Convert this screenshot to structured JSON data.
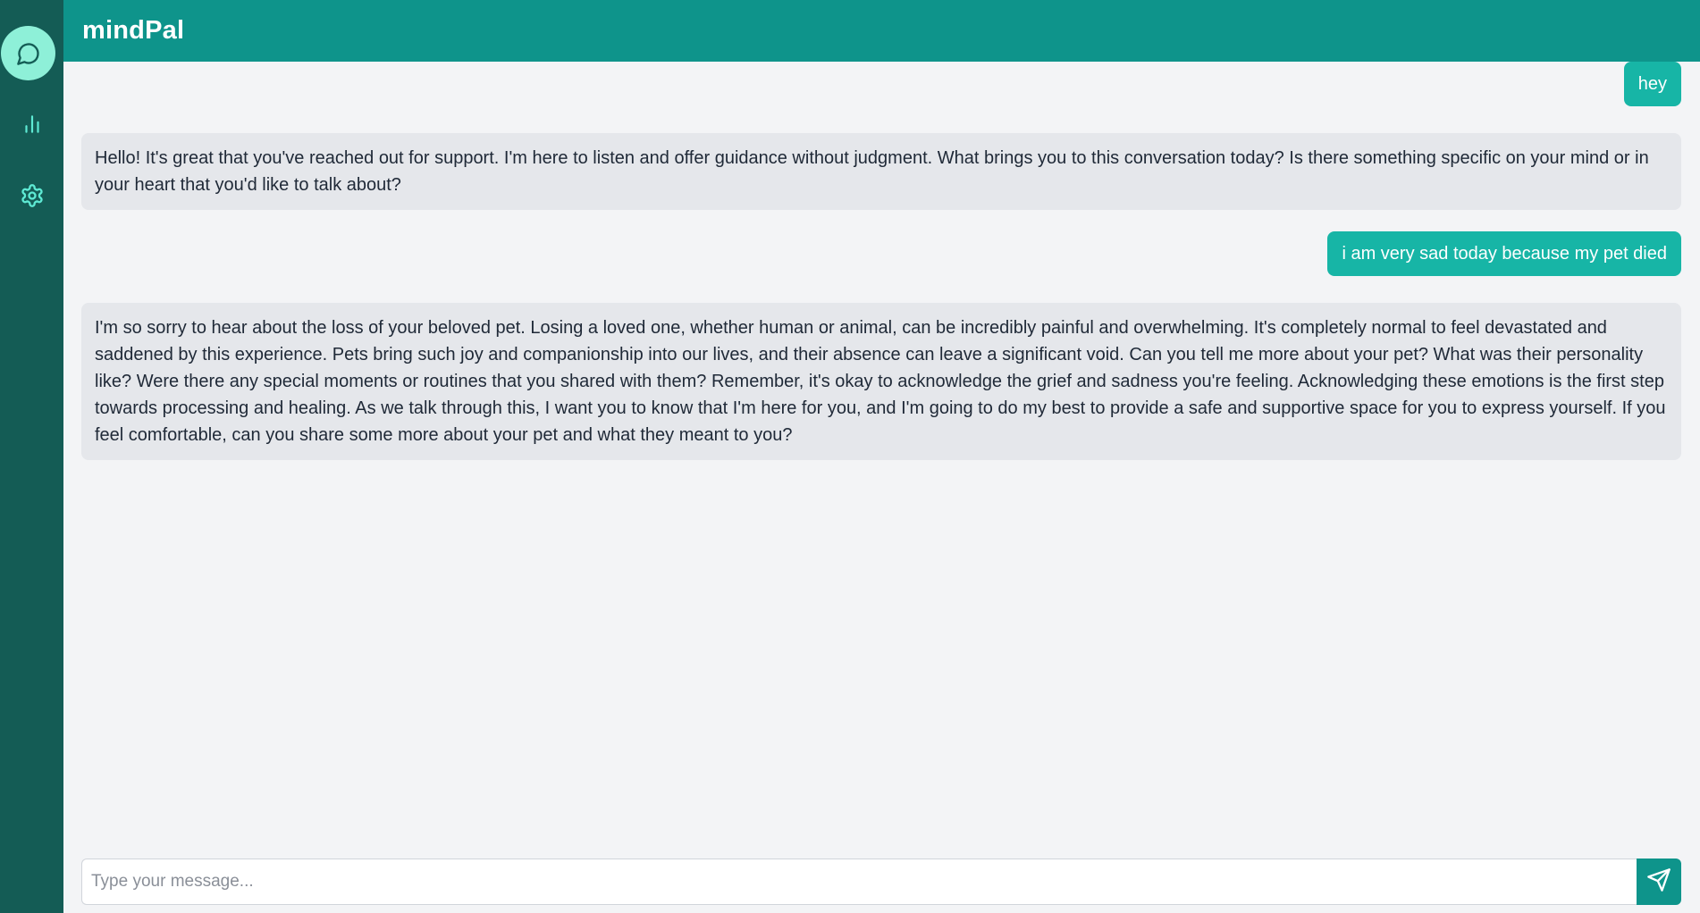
{
  "app": {
    "title": "mindPal"
  },
  "sidebar": {
    "items": [
      {
        "name": "chat",
        "icon": "chat-bubble-icon",
        "active": true
      },
      {
        "name": "stats",
        "icon": "bar-chart-icon",
        "active": false
      },
      {
        "name": "settings",
        "icon": "gear-icon",
        "active": false
      }
    ]
  },
  "colors": {
    "sidebar": "#145c55",
    "header": "#0e948b",
    "user_bubble": "#17b5a6",
    "bot_bubble": "#e5e7eb",
    "active_nav": "#8ef0d8"
  },
  "messages": [
    {
      "role": "user",
      "text": "hey"
    },
    {
      "role": "bot",
      "text": "Hello! It's great that you've reached out for support. I'm here to listen and offer guidance without judgment. What brings you to this conversation today? Is there something specific on your mind or in your heart that you'd like to talk about?"
    },
    {
      "role": "user",
      "text": "i am very sad today because my pet died"
    },
    {
      "role": "bot",
      "text": "I'm so sorry to hear about the loss of your beloved pet. Losing a loved one, whether human or animal, can be incredibly painful and overwhelming. It's completely normal to feel devastated and saddened by this experience. Pets bring such joy and companionship into our lives, and their absence can leave a significant void. Can you tell me more about your pet? What was their personality like? Were there any special moments or routines that you shared with them? Remember, it's okay to acknowledge the grief and sadness you're feeling. Acknowledging these emotions is the first step towards processing and healing. As we talk through this, I want you to know that I'm here for you, and I'm going to do my best to provide a safe and supportive space for you to express yourself. If you feel comfortable, can you share some more about your pet and what they meant to you?"
    }
  ],
  "composer": {
    "placeholder": "Type your message...",
    "value": "",
    "send_icon": "send-icon"
  }
}
